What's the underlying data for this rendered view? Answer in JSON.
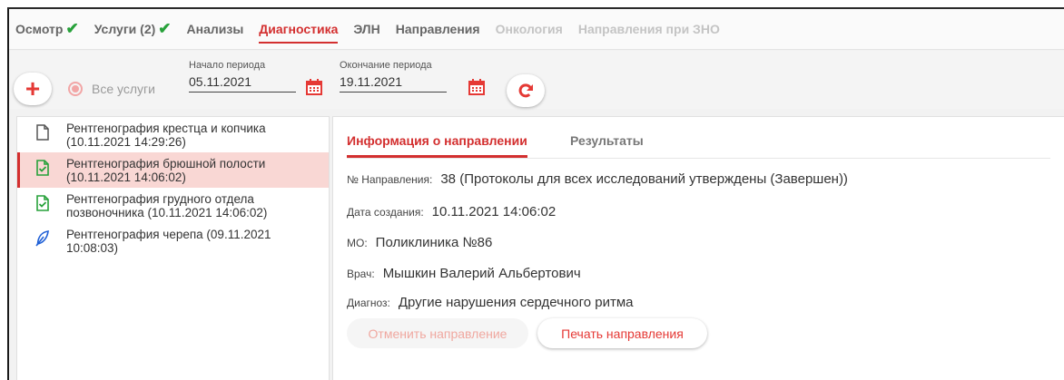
{
  "tabs": [
    {
      "label": "Осмотр",
      "check": true,
      "state": "normal"
    },
    {
      "label": "Услуги (2)",
      "check": true,
      "state": "normal"
    },
    {
      "label": "Анализы",
      "check": false,
      "state": "normal"
    },
    {
      "label": "Диагностика",
      "check": false,
      "state": "active"
    },
    {
      "label": "ЭЛН",
      "check": false,
      "state": "normal"
    },
    {
      "label": "Направления",
      "check": false,
      "state": "normal"
    },
    {
      "label": "Онкология",
      "check": false,
      "state": "disabled"
    },
    {
      "label": "Направления при ЗНО",
      "check": false,
      "state": "disabled"
    }
  ],
  "toolbar": {
    "add_icon": "plus-icon",
    "all_services_label": "Все услуги",
    "period_start_label": "Начало периода",
    "period_start_value": "05.11.2021",
    "period_end_label": "Окончание периода",
    "period_end_value": "19.11.2021",
    "refresh_icon": "refresh-icon"
  },
  "studies": [
    {
      "text": "Рентгенография крестца и копчика (10.11.2021 14:29:26)",
      "icon": "document-icon",
      "selected": false
    },
    {
      "text": "Рентгенография брюшной полости (10.11.2021 14:06:02)",
      "icon": "document-check-icon",
      "selected": true
    },
    {
      "text": "Рентгенография грудного отдела позвоночника (10.11.2021 14:06:02)",
      "icon": "document-check-icon",
      "selected": false
    },
    {
      "text": "Рентгенография черепа (09.11.2021 10:08:03)",
      "icon": "feather-pen-icon",
      "selected": false
    }
  ],
  "detail": {
    "tabs": {
      "info": "Информация о направлении",
      "results": "Результаты"
    },
    "referral_number_label": "№ Направления:",
    "referral_number_value": "38 (Протоколы для всех исследований утверждены (Завершен))",
    "created_label": "Дата создания:",
    "created_value": "10.11.2021 14:06:02",
    "mo_label": "МО:",
    "mo_value": "Поликлиника №86",
    "doctor_label": "Врач:",
    "doctor_value": "Мышкин Валерий Альбертович",
    "diagnosis_label": "Диагноз:",
    "diagnosis_value": "Другие нарушения сердечного ритма",
    "cancel_button": "Отменить направление",
    "print_button": "Печать направления"
  },
  "colors": {
    "accent": "#d32f2f",
    "check": "#27a13a",
    "selected_bg": "#f9d7d4"
  }
}
